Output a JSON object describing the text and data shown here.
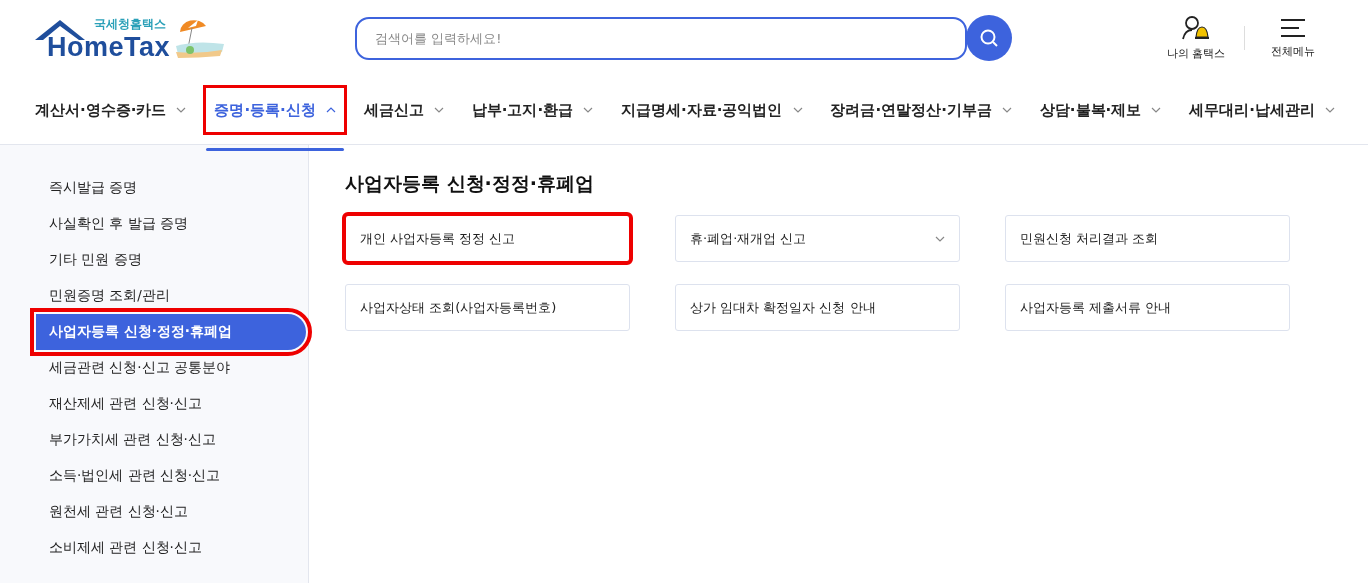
{
  "logo": {
    "subtitle": "국세청홈택스",
    "title": "HomeTax"
  },
  "search": {
    "placeholder": "검색어를 입력하세요!"
  },
  "utility": [
    {
      "kind": "user",
      "label": "나의 홈택스"
    },
    {
      "kind": "menu",
      "label": "전체메뉴"
    }
  ],
  "nav": [
    {
      "label": "계산서·영수증·카드",
      "selected": false,
      "expanded": false,
      "highlighted": false
    },
    {
      "label": "증명·등록·신청",
      "selected": true,
      "expanded": true,
      "highlighted": true
    },
    {
      "label": "세금신고",
      "selected": false,
      "expanded": false,
      "highlighted": false
    },
    {
      "label": "납부·고지·환급",
      "selected": false,
      "expanded": false,
      "highlighted": false
    },
    {
      "label": "지급명세·자료·공익법인",
      "selected": false,
      "expanded": false,
      "highlighted": false
    },
    {
      "label": "장려금·연말정산·기부금",
      "selected": false,
      "expanded": false,
      "highlighted": false
    },
    {
      "label": "상담·불복·제보",
      "selected": false,
      "expanded": false,
      "highlighted": false
    },
    {
      "label": "세무대리·납세관리",
      "selected": false,
      "expanded": false,
      "highlighted": false
    }
  ],
  "sidebar": {
    "items": [
      {
        "label": "즉시발급 증명",
        "selected": false,
        "highlighted": false
      },
      {
        "label": "사실확인 후 발급 증명",
        "selected": false,
        "highlighted": false
      },
      {
        "label": "기타 민원 증명",
        "selected": false,
        "highlighted": false
      },
      {
        "label": "민원증명 조회/관리",
        "selected": false,
        "highlighted": false
      },
      {
        "label": "사업자등록 신청·정정·휴폐업",
        "selected": true,
        "highlighted": true
      },
      {
        "label": "세금관련 신청·신고 공통분야",
        "selected": false,
        "highlighted": false
      },
      {
        "label": "재산제세 관련 신청·신고",
        "selected": false,
        "highlighted": false
      },
      {
        "label": "부가가치세 관련 신청·신고",
        "selected": false,
        "highlighted": false
      },
      {
        "label": "소득·법인세 관련 신청·신고",
        "selected": false,
        "highlighted": false
      },
      {
        "label": "원천세 관련 신청·신고",
        "selected": false,
        "highlighted": false
      },
      {
        "label": "소비제세 관련 신청·신고",
        "selected": false,
        "highlighted": false
      }
    ]
  },
  "content": {
    "title": "사업자등록 신청·정정·휴폐업",
    "cards": [
      {
        "label": "개인 사업자등록 정정 신고",
        "kind": "link",
        "highlighted": true
      },
      {
        "label": "휴·폐업·재개업 신고",
        "kind": "dropdown",
        "highlighted": false
      },
      {
        "label": "민원신청 처리결과 조회",
        "kind": "link",
        "highlighted": false
      },
      {
        "label": "사업자상태 조회(사업자등록번호)",
        "kind": "link",
        "highlighted": false
      },
      {
        "label": "상가 임대차 확정일자 신청 안내",
        "kind": "link",
        "highlighted": false
      },
      {
        "label": "사업자등록 제출서류 안내",
        "kind": "link",
        "highlighted": false
      }
    ]
  }
}
